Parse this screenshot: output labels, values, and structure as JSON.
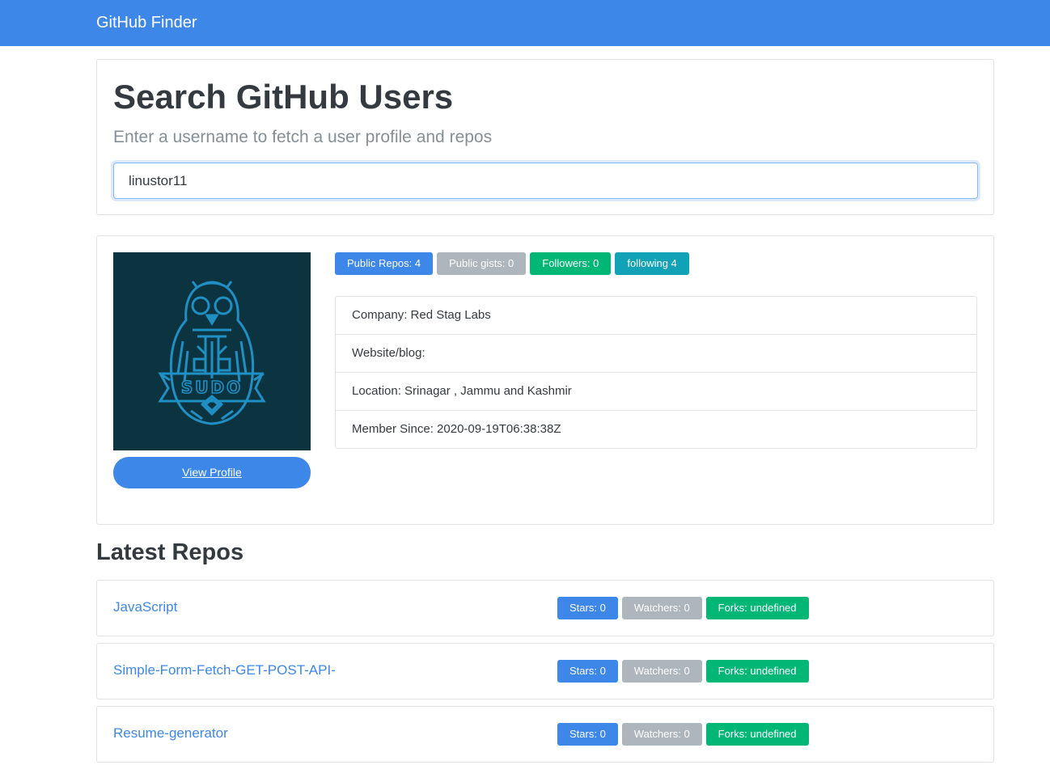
{
  "navbar": {
    "brand": "GitHub Finder"
  },
  "search": {
    "title": "Search GitHub Users",
    "subtitle": "Enter a username to fetch a user profile and repos",
    "value": "linustor11"
  },
  "profile": {
    "avatar_text": "SUDO",
    "view_profile_label": "View Profile",
    "badges": {
      "public_repos": "Public Repos: 4",
      "public_gists": "Public gists: 0",
      "followers": "Followers: 0",
      "following": "following 4"
    },
    "info": {
      "company": "Company: Red Stag Labs",
      "website": "Website/blog:",
      "location": "Location: Srinagar , Jammu and Kashmir",
      "member_since": "Member Since: 2020-09-19T06:38:38Z"
    }
  },
  "repos": {
    "heading": "Latest Repos",
    "items": [
      {
        "name": "JavaScript",
        "stars": "Stars: 0",
        "watchers": "Watchers: 0",
        "forks": "Forks: undefined"
      },
      {
        "name": "Simple-Form-Fetch-GET-POST-API-",
        "stars": "Stars: 0",
        "watchers": "Watchers: 0",
        "forks": "Forks: undefined"
      },
      {
        "name": "Resume-generator",
        "stars": "Stars: 0",
        "watchers": "Watchers: 0",
        "forks": "Forks: undefined"
      }
    ]
  },
  "colors": {
    "primary": "#3d87e8",
    "secondary": "#adb5bd",
    "success": "#00b776",
    "info": "#11a2b8",
    "avatar_bg": "#0b3340",
    "avatar_art": "#1f8fc4"
  }
}
